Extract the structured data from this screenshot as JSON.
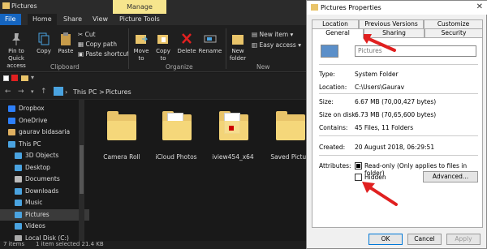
{
  "explorer": {
    "title": "Pictures",
    "manage_tab": "Manage",
    "menu": [
      "File",
      "Home",
      "Share",
      "View",
      "Picture Tools"
    ],
    "ribbon": {
      "pin_label": "Pin to Quick access",
      "copy_label": "Copy",
      "paste_label": "Paste",
      "cut_label": "Cut",
      "copy_path_label": "Copy path",
      "paste_shortcut_label": "Paste shortcut",
      "clipboard_group": "Clipboard",
      "move_to_label": "Move to",
      "copy_to_label": "Copy to",
      "delete_label": "Delete",
      "rename_label": "Rename",
      "organize_group": "Organize",
      "new_folder_label": "New folder",
      "new_item_label": "New item",
      "easy_access_label": "Easy access",
      "new_group": "New"
    },
    "address": {
      "this_pc": "This PC",
      "sep": ">",
      "folder": "Pictures"
    },
    "nav_items": [
      {
        "label": "Dropbox",
        "icon": "dropbox-icon",
        "color": "#2d7ff9"
      },
      {
        "label": "OneDrive",
        "icon": "cloud-icon",
        "color": "#2d7ff9"
      },
      {
        "label": "gaurav bidasaria",
        "icon": "user-icon",
        "color": "#e0b060"
      },
      {
        "label": "This PC",
        "icon": "computer-icon",
        "color": "#4aa3e0"
      },
      {
        "label": "3D Objects",
        "icon": "cube-icon",
        "color": "#4aa3e0"
      },
      {
        "label": "Desktop",
        "icon": "desktop-icon",
        "color": "#4aa3e0"
      },
      {
        "label": "Documents",
        "icon": "document-icon",
        "color": "#bbbbbb"
      },
      {
        "label": "Downloads",
        "icon": "download-icon",
        "color": "#4aa3e0"
      },
      {
        "label": "Music",
        "icon": "music-icon",
        "color": "#4aa3e0"
      },
      {
        "label": "Pictures",
        "icon": "pictures-icon",
        "color": "#4aa3e0"
      },
      {
        "label": "Videos",
        "icon": "video-icon",
        "color": "#4aa3e0"
      },
      {
        "label": "Local Disk (C:)",
        "icon": "disk-icon",
        "color": "#aaaaaa"
      }
    ],
    "folders": [
      {
        "label": "Camera Roll"
      },
      {
        "label": "iCloud Photos"
      },
      {
        "label": "iview454_x64"
      },
      {
        "label": "Saved Picture"
      }
    ],
    "status": {
      "items": "7 items",
      "selected": "1 item selected  21.4 KB"
    }
  },
  "dialog": {
    "title": "Pictures Properties",
    "close": "✕",
    "tabs_top": [
      "Location",
      "Previous Versions",
      "Customize"
    ],
    "tabs_bottom": [
      "General",
      "Sharing",
      "Security"
    ],
    "name_value": "Pictures",
    "rows": [
      {
        "label": "Type:",
        "value": "System Folder"
      },
      {
        "label": "Location:",
        "value": "C:\\Users\\Gaurav"
      },
      {
        "label": "Size:",
        "value": "6.67 MB (70,00,427 bytes)"
      },
      {
        "label": "Size on disk:",
        "value": "6.73 MB (70,65,600 bytes)"
      },
      {
        "label": "Contains:",
        "value": "45 Files, 11 Folders"
      },
      {
        "label": "Created:",
        "value": "20 August 2018, 06:29:51"
      }
    ],
    "attributes_label": "Attributes:",
    "readonly_label": "Read-only (Only applies to files in folder)",
    "hidden_label": "Hidden",
    "advanced_label": "Advanced...",
    "ok": "OK",
    "cancel": "Cancel",
    "apply": "Apply"
  },
  "colors": {
    "accent": "#0078d7",
    "arrow": "#e02020",
    "folder": "#e9c46a"
  }
}
